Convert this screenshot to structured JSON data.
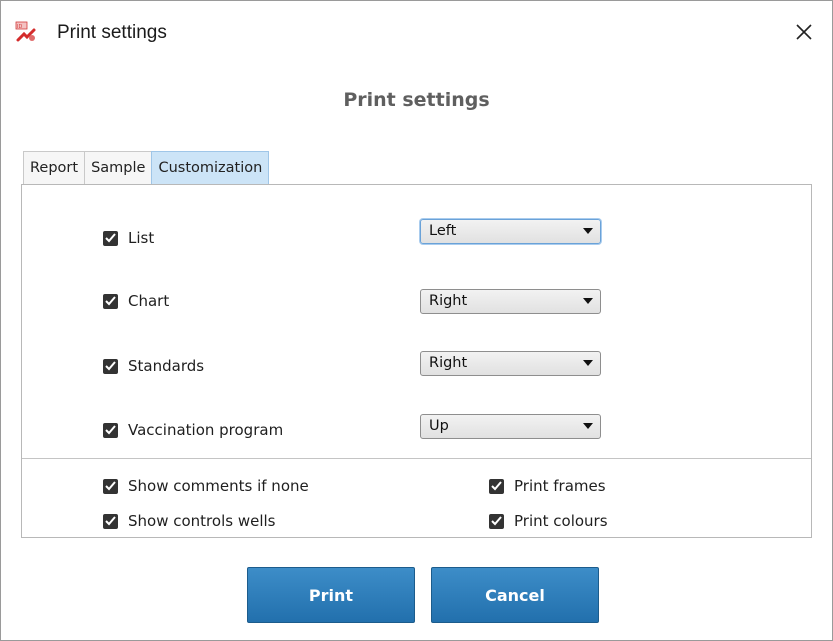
{
  "window": {
    "title": "Print settings",
    "icon": "print-settings-app-icon",
    "close_icon": "close-icon"
  },
  "heading": "Print settings",
  "tabs": [
    {
      "label": "Report",
      "active": false
    },
    {
      "label": "Sample",
      "active": false
    },
    {
      "label": "Customization",
      "active": true
    }
  ],
  "sections": [
    {
      "label": "List",
      "checked": true,
      "position": "Left",
      "focused": true
    },
    {
      "label": "Chart",
      "checked": true,
      "position": "Right",
      "focused": false
    },
    {
      "label": "Standards",
      "checked": true,
      "position": "Right",
      "focused": false
    },
    {
      "label": "Vaccination program",
      "checked": true,
      "position": "Up",
      "focused": false
    }
  ],
  "options": {
    "show_comments": {
      "label": "Show comments if none",
      "checked": true
    },
    "show_controls": {
      "label": "Show controls wells",
      "checked": true
    },
    "print_frames": {
      "label": "Print frames",
      "checked": true
    },
    "print_colours": {
      "label": "Print colours",
      "checked": true
    }
  },
  "buttons": {
    "print": "Print",
    "cancel": "Cancel"
  },
  "colors": {
    "active_tab": "#cce4f7",
    "button": "#2a78b5",
    "checkbox": "#333333"
  }
}
